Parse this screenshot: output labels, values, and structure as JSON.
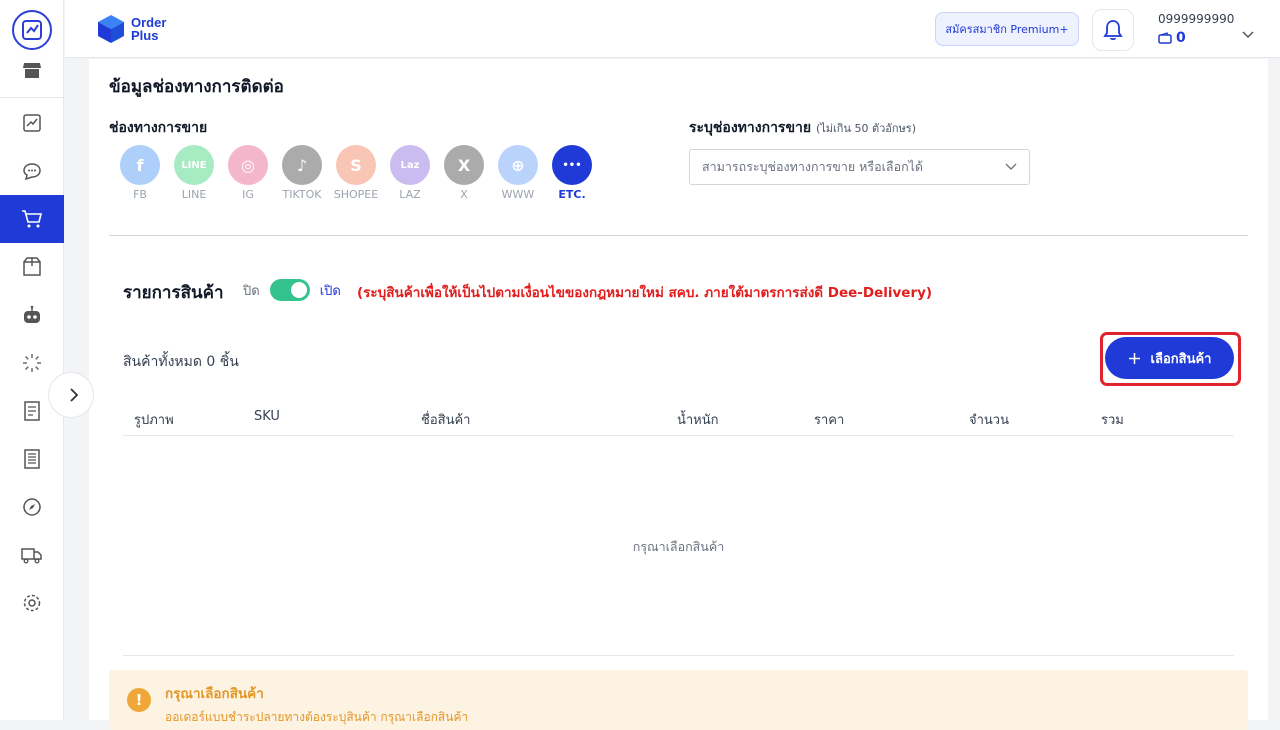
{
  "header": {
    "brand_line1": "Order",
    "brand_line2": "Plus",
    "premium_label": "สมัครสมาชิก Premium+",
    "user_phone": "0999999990",
    "wallet_balance": "0"
  },
  "sidebar": {
    "items": [
      {
        "name": "store-icon"
      },
      {
        "name": "chart-icon"
      },
      {
        "name": "chat-icon"
      },
      {
        "name": "cart-icon",
        "active": true
      },
      {
        "name": "package-icon"
      },
      {
        "name": "robot-icon"
      },
      {
        "name": "loader-icon"
      },
      {
        "name": "document-icon"
      },
      {
        "name": "list-document-icon"
      },
      {
        "name": "compass-icon"
      },
      {
        "name": "truck-icon"
      },
      {
        "name": "gear-icon"
      }
    ],
    "accent": "#1f3ad6"
  },
  "contact": {
    "title": "ข้อมูลช่องทางการติดต่อ",
    "channels_label": "ช่องทางการขาย",
    "specify_label": "ระบุช่องทางการขาย",
    "specify_hint": "(ไม่เกิน 50 ตัวอักษร)",
    "specify_placeholder": "สามารถระบุช่องทางการขาย หรือเลือกได้",
    "channels": [
      {
        "label": "FB",
        "color": "#1877f2",
        "glyph": "f"
      },
      {
        "label": "LINE",
        "color": "#06c755",
        "glyph": "LINE"
      },
      {
        "label": "IG",
        "color": "#e1306c",
        "glyph": "◎"
      },
      {
        "label": "TIKTOK",
        "color": "#111111",
        "glyph": "♪"
      },
      {
        "label": "SHOPEE",
        "color": "#f05d2f",
        "glyph": "S"
      },
      {
        "label": "LAZ",
        "color": "#6b3fd6",
        "glyph": "Laz"
      },
      {
        "label": "X",
        "color": "#111111",
        "glyph": "X"
      },
      {
        "label": "WWW",
        "color": "#3b82f6",
        "glyph": "⊕"
      },
      {
        "label": "ETC.",
        "color": "#1f3ad6",
        "glyph": "•••",
        "selected": true
      }
    ]
  },
  "products": {
    "title": "รายการสินค้า",
    "toggle_off": "ปิด",
    "toggle_on": "เปิด",
    "warning": "(ระบุสินค้าเพื่อให้เป็นไปตามเงื่อนไขของกฎหมายใหม่ สคบ. ภายใต้มาตรการส่งดี Dee-Delivery)",
    "total": "สินค้าทั้งหมด 0 ชิ้น",
    "select_button": "เลือกสินค้า",
    "columns": [
      "รูปภาพ",
      "SKU",
      "ชื่อสินค้า",
      "น้ำหนัก",
      "ราคา",
      "จำนวน",
      "รวม"
    ],
    "empty": "กรุณาเลือกสินค้า"
  },
  "alert": {
    "title": "กรุณาเลือกสินค้า",
    "body": "ออเดอร์แบบชำระปลายทางต้องระบุสินค้า กรุณาเลือกสินค้า"
  }
}
